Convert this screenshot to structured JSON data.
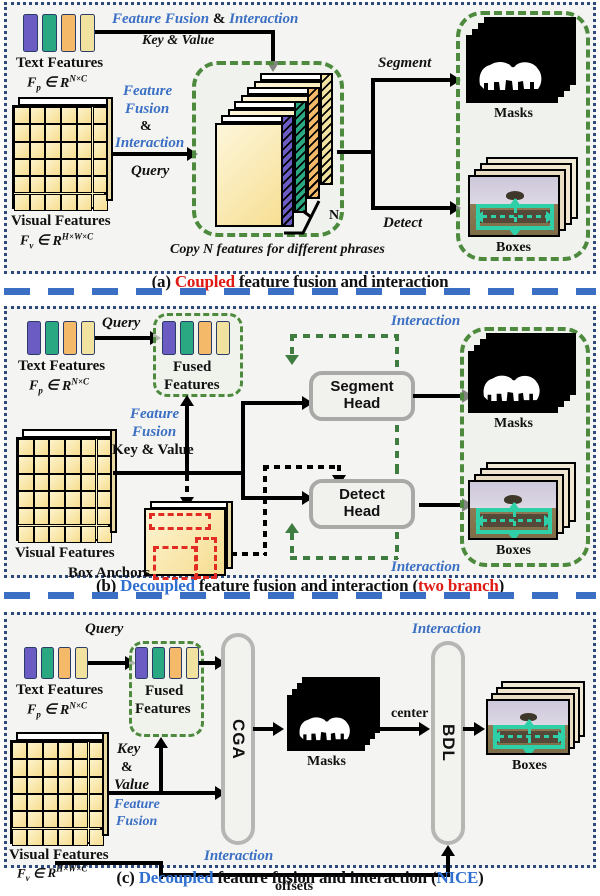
{
  "figure": {
    "panels": [
      {
        "id": "a",
        "caption_prefix": "(a) ",
        "caption_key": "Coupled",
        "caption_rest": " feature fusion and interaction",
        "labels": {
          "text_features": "Text Features",
          "text_features_dim": "Fp ∈ R^{N×C}",
          "visual_features": "Visual Features",
          "visual_features_dim": "Fv ∈ R^{H×W×C}",
          "top_italic": "Feature Fusion & Interaction",
          "key_value": "Key & Value",
          "mid_fusion_1": "Feature",
          "mid_fusion_2": "Fusion",
          "mid_fusion_3": "&",
          "mid_fusion_4": "Interaction",
          "query": "Query",
          "copy_note": "Copy N features for different phrases",
          "n_label": "N",
          "segment": "Segment",
          "detect": "Detect",
          "masks": "Masks",
          "boxes": "Boxes"
        }
      },
      {
        "id": "b",
        "caption_prefix": "(b) ",
        "caption_key": "Decoupled",
        "caption_rest": " feature fusion and interaction (",
        "caption_suffix_key": "two branch",
        "caption_suffix_rest": ")",
        "labels": {
          "query": "Query",
          "text_features": "Text Features",
          "text_features_dim": "Fp ∈ R^{N×C}",
          "fused_features_1": "Fused",
          "fused_features_2": "Features",
          "interaction_top": "Interaction",
          "interaction_bottom": "Interaction",
          "feature_fusion_1": "Feature",
          "feature_fusion_2": "Fusion",
          "key_value": "Key & Value",
          "visual_features": "Visual Features",
          "box_anchors": "Box Anchors",
          "segment_head": "Segment\nHead",
          "detect_head": "Detect\nHead",
          "masks": "Masks",
          "boxes": "Boxes"
        }
      },
      {
        "id": "c",
        "caption_prefix": "(c) ",
        "caption_key": "Decoupled",
        "caption_rest": " feature fusion and interaction (",
        "caption_suffix_key": "NICE",
        "caption_suffix_rest": ")",
        "labels": {
          "query": "Query",
          "text_features": "Text Features",
          "text_features_dim": "Fp ∈ R^{N×C}",
          "fused_features_1": "Fused",
          "fused_features_2": "Features",
          "key": "Key",
          "amp": "&",
          "value": "Value",
          "feature_fusion_1": "Feature",
          "feature_fusion_2": "Fusion",
          "visual_features": "Visual Features",
          "visual_features_dim": "Fv ∈ R^{H×W×C}",
          "cga": "CGA",
          "bdl": "BDL",
          "interaction_cga": "Interaction",
          "interaction_bdl": "Interaction",
          "masks": "Masks",
          "boxes": "Boxes",
          "center": "center",
          "offsets": "offsets"
        }
      }
    ],
    "text_feature_bar_colors": [
      "#6b5cc4",
      "#2aa882",
      "#f5b96a",
      "#f2e2a0"
    ],
    "colors": {
      "panel_border": "#2e4a7d",
      "separator": "#3a6fc4",
      "green_dashed": "#4e8a3e",
      "accent_blue": "#3a6fc4",
      "accent_red": "#e01b13",
      "bbox_teal": "#2fcfa8",
      "anchor_red": "#e22b22",
      "visual_feature_yellow": "#f6dd8f",
      "head_border_gray": "#a9aaa8"
    }
  }
}
